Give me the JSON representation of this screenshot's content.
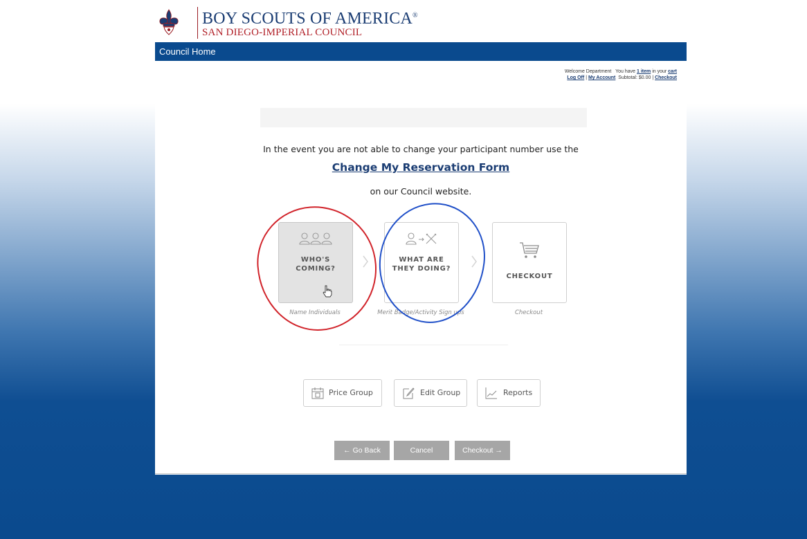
{
  "header": {
    "title": "BOY SCOUTS OF AMERICA",
    "trademark": "®",
    "subtitle": "SAN DIEGO-IMPERIAL COUNCIL"
  },
  "nav": {
    "council_home": "Council Home"
  },
  "account": {
    "welcome": "Welcome Department",
    "you_have": "You have",
    "items": "1 item",
    "in_your": "in your",
    "cart": "cart",
    "log_off": "Log Off",
    "sep": "|",
    "my_account": "My Account",
    "subtotal": "Subtotal: $0.00 |",
    "checkout": "Checkout"
  },
  "main": {
    "message_line1": "In the event you are not able to change your participant number use the",
    "form_link": "Change My Reservation Form",
    "message_line2": "on our Council website."
  },
  "steps": [
    {
      "line1": "WHO'S",
      "line2": "COMING?",
      "caption": "Name Individuals",
      "icon": "users-icon",
      "active": true
    },
    {
      "line1": "WHAT ARE",
      "line2": "THEY DOING?",
      "caption": "Merit Badge/Activity Sign ups",
      "icon": "user-activity-icon",
      "active": false
    },
    {
      "line1": "CHECKOUT",
      "caption": "Checkout",
      "icon": "cart-icon",
      "active": false
    }
  ],
  "tools": {
    "price_group": "Price Group",
    "edit_group": "Edit Group",
    "reports": "Reports"
  },
  "actions": {
    "go_back": "← Go Back",
    "cancel": "Cancel",
    "checkout": "Checkout →"
  },
  "colors": {
    "brand_blue": "#0a4a8e",
    "brand_red": "#b01e26",
    "annotation_red": "#d1232a",
    "annotation_blue": "#1f4fc8"
  }
}
